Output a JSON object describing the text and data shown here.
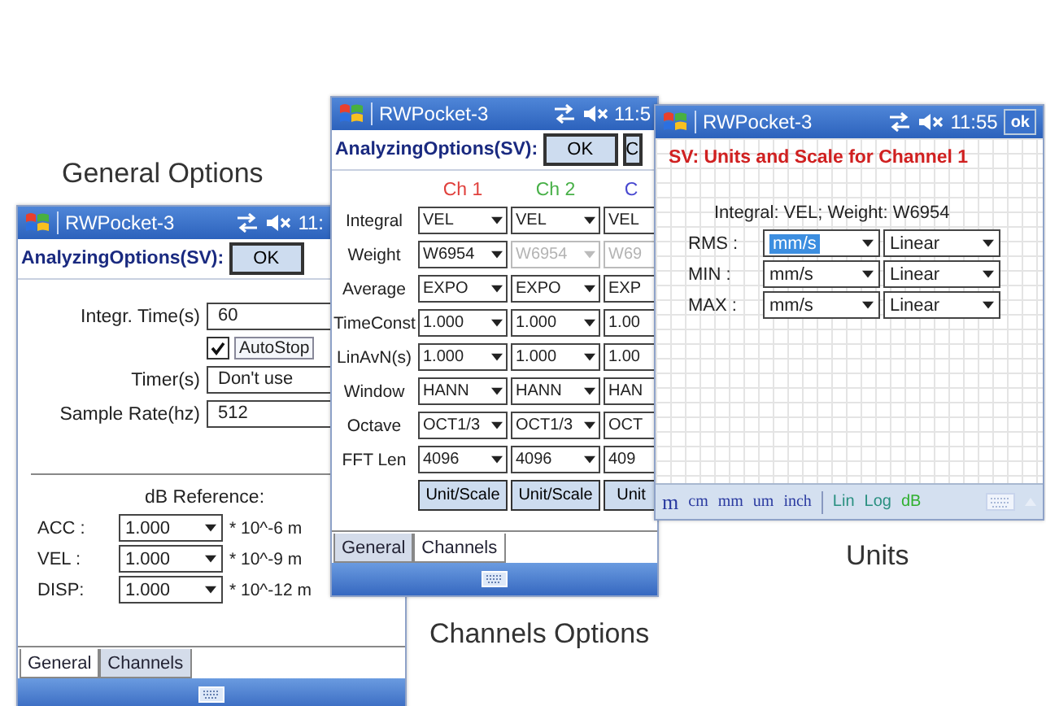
{
  "general_window": {
    "caption": "General Options",
    "title": "RWPocket-3",
    "time": "11:",
    "header": "AnalyzingOptions(SV):",
    "ok_button": "OK",
    "fields": [
      {
        "kind": "input",
        "label": "Integr. Time(s)",
        "value": "60"
      },
      {
        "kind": "checkbox",
        "label": "AutoStop",
        "checked": true
      },
      {
        "kind": "input",
        "label": "Timer(s)",
        "value": "Don't use"
      },
      {
        "kind": "input",
        "label": "Sample Rate(hz)",
        "value": "512"
      }
    ],
    "db_reference": {
      "title": "dB Reference:",
      "rows": [
        {
          "label": "ACC :",
          "value": "1.000",
          "unit": "* 10^-6 m"
        },
        {
          "label": "VEL :",
          "value": "1.000",
          "unit": "* 10^-9 m"
        },
        {
          "label": "DISP:",
          "value": "1.000",
          "unit": "* 10^-12 m"
        }
      ]
    },
    "tabs": [
      {
        "label": "General",
        "selected": true
      },
      {
        "label": "Channels",
        "selected": false
      }
    ]
  },
  "channels_window": {
    "caption": "Channels Options",
    "title": "RWPocket-3",
    "time": "11:5",
    "header": "AnalyzingOptions(SV):",
    "buttons": [
      "OK",
      "C"
    ],
    "channels": [
      {
        "label": "Ch 1",
        "color": "#e0403c"
      },
      {
        "label": "Ch 2",
        "color": "#48b048"
      },
      {
        "label": "C",
        "color": "#4848d0"
      }
    ],
    "rows": [
      {
        "label": "Integral",
        "cells": [
          {
            "value": "VEL",
            "disabled": false
          },
          {
            "value": "VEL",
            "disabled": false
          },
          {
            "value": "VEL",
            "disabled": false
          }
        ]
      },
      {
        "label": "Weight",
        "cells": [
          {
            "value": "W6954",
            "disabled": false
          },
          {
            "value": "W6954",
            "disabled": true
          },
          {
            "value": "W69",
            "disabled": true
          }
        ]
      },
      {
        "label": "Average",
        "cells": [
          {
            "value": "EXPO",
            "disabled": false
          },
          {
            "value": "EXPO",
            "disabled": false
          },
          {
            "value": "EXP",
            "disabled": false
          }
        ]
      },
      {
        "label": "TimeConst",
        "cells": [
          {
            "value": "1.000",
            "disabled": false
          },
          {
            "value": "1.000",
            "disabled": false
          },
          {
            "value": "1.00",
            "disabled": false
          }
        ]
      },
      {
        "label": "LinAvN(s)",
        "cells": [
          {
            "value": "1.000",
            "disabled": false
          },
          {
            "value": "1.000",
            "disabled": false
          },
          {
            "value": "1.00",
            "disabled": false
          }
        ]
      },
      {
        "label": "Window",
        "cells": [
          {
            "value": "HANN",
            "disabled": false
          },
          {
            "value": "HANN",
            "disabled": false
          },
          {
            "value": "HAN",
            "disabled": false
          }
        ]
      },
      {
        "label": "Octave",
        "cells": [
          {
            "value": "OCT1/3",
            "disabled": false
          },
          {
            "value": "OCT1/3",
            "disabled": false
          },
          {
            "value": "OCT",
            "disabled": false
          }
        ]
      },
      {
        "label": "FFT Len",
        "cells": [
          {
            "value": "4096",
            "disabled": false
          },
          {
            "value": "4096",
            "disabled": false
          },
          {
            "value": "409",
            "disabled": false
          }
        ]
      }
    ],
    "unit_buttons": [
      "Unit/Scale",
      "Unit/Scale",
      "Unit"
    ],
    "tabs": [
      {
        "label": "General",
        "selected": false
      },
      {
        "label": "Channels",
        "selected": true
      }
    ]
  },
  "units_window": {
    "caption": "Units",
    "title": "RWPocket-3",
    "time": "11:55",
    "ok_button": "ok",
    "heading": "SV: Units and Scale for Channel 1",
    "summary": "Integral: VEL;  Weight: W6954",
    "rows": [
      {
        "label": "RMS :",
        "unit": "mm/s",
        "unit_selected": true,
        "scale": "Linear"
      },
      {
        "label": "MIN :",
        "unit": "mm/s",
        "unit_selected": false,
        "scale": "Linear"
      },
      {
        "label": "MAX :",
        "unit": "mm/s",
        "unit_selected": false,
        "scale": "Linear"
      }
    ],
    "toolbar": {
      "units": [
        "m",
        "cm",
        "mm",
        "um",
        "inch"
      ],
      "scales": [
        "Lin",
        "Log",
        "dB"
      ]
    }
  }
}
